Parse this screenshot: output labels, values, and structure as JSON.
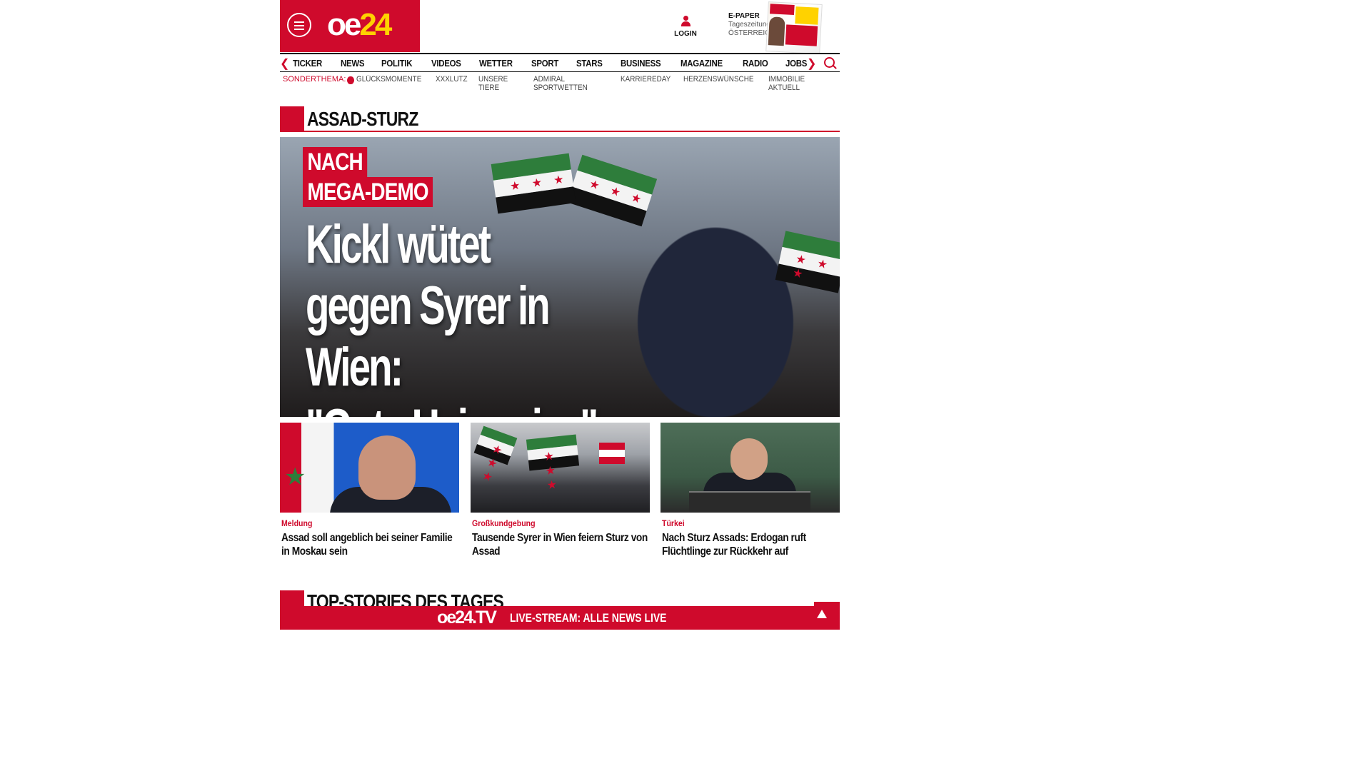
{
  "header": {
    "logo_main": "oe",
    "logo_accent": "24",
    "login_label": "LOGIN",
    "epaper_title": "E-PAPER",
    "epaper_line1": "Tageszeitung",
    "epaper_line2": "ÖSTERREICH"
  },
  "nav": {
    "items": [
      "TICKER",
      "NEWS",
      "POLITIK",
      "VIDEOS",
      "WETTER",
      "SPORT",
      "STARS",
      "BUSINESS",
      "MAGAZINE",
      "RADIO",
      "JOBS"
    ],
    "prev_icon": "chevron-left-icon",
    "next_icon": "chevron-right-icon"
  },
  "subnav": {
    "label": "SONDERTHEMA:",
    "items": [
      "GLÜCKSMOMENTE",
      "XXXLUTZ",
      "UNSERE TIERE",
      "ADMIRAL SPORTWETTEN",
      "KARRIEREDAY",
      "HERZENSWÜNSCHE",
      "IMMOBILIE AKTUELL"
    ]
  },
  "section": {
    "title": "ASSAD-STURZ"
  },
  "hero": {
    "kicker_line1": "NACH",
    "kicker_line2": "MEGA-DEMO",
    "headline_line1": "Kickl wütet",
    "headline_line2": "gegen Syrer in Wien:",
    "headline_line3": "\"Gute Heimreise\""
  },
  "cards": [
    {
      "category": "Meldung",
      "title": "Assad soll angeblich bei seiner Familie in Moskau sein"
    },
    {
      "category": "Großkundgebung",
      "title": "Tausende Syrer in Wien feiern Sturz von Assad"
    },
    {
      "category": "Türkei",
      "title": "Nach Sturz Assads: Erdogan ruft Flüchtlinge zur Rückkehr auf"
    }
  ],
  "section2": {
    "title": "TOP-STORIES DES TAGES"
  },
  "tvbar": {
    "logo": "oe24.TV",
    "text": "LIVE-STREAM: ALLE NEWS LIVE"
  },
  "colors": {
    "brand_red": "#cf0a2c",
    "logo_yellow": "#ffd200"
  }
}
